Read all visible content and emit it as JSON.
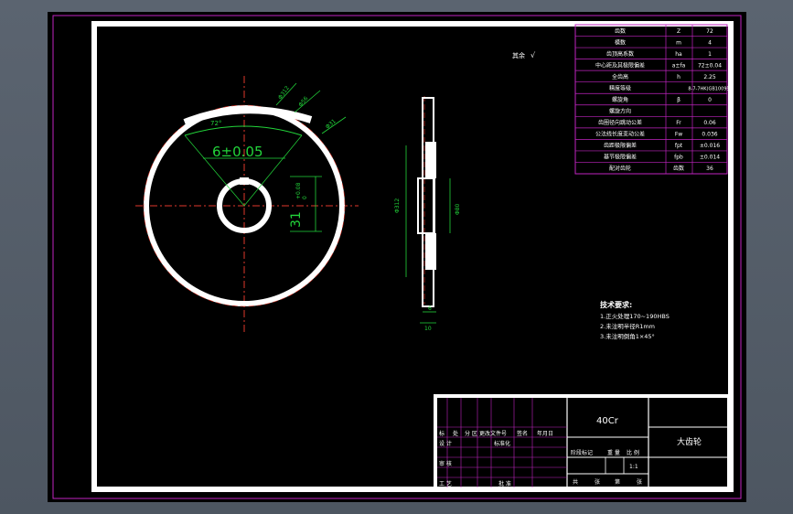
{
  "drawing": {
    "material": "40Cr",
    "part_name": "大齿轮",
    "note_top": "其余",
    "scale": "1:1"
  },
  "dims": {
    "key_width": "6±0.05",
    "key_depth": "31",
    "key_depth_upper": "+0.08",
    "key_depth_lower": "0",
    "angle": "72°",
    "bore_left": "Φ",
    "dim_d1": "Φ312",
    "dim_d2": "Φ56",
    "dim_d3": "Φ31",
    "side_height": "Φ312",
    "side_inner": "Φ80",
    "hub_width": "6",
    "face_width": "10"
  },
  "params": [
    {
      "name": "齿数",
      "sym": "Z",
      "val": "72"
    },
    {
      "name": "模数",
      "sym": "m",
      "val": "4"
    },
    {
      "name": "齿顶高系数",
      "sym": "ha",
      "val": "1"
    },
    {
      "name": "中心距及其极限偏差",
      "sym": "a±fa",
      "val": "72±0.04"
    },
    {
      "name": "全齿高",
      "sym": "h",
      "val": "2.25"
    },
    {
      "name": "精度等级",
      "sym": "",
      "val": "8-7-7HK(GB10095)"
    },
    {
      "name": "螺旋角",
      "sym": "β",
      "val": "0"
    },
    {
      "name": "螺旋方向",
      "sym": "",
      "val": ""
    },
    {
      "name": "齿圈径向跳动公差",
      "sym": "Fr",
      "val": "0.06"
    },
    {
      "name": "公法线长度变动公差",
      "sym": "Fw",
      "val": "0.036"
    },
    {
      "name": "齿距极限偏差",
      "sym": "fpt",
      "val": "±0.016"
    },
    {
      "name": "基节极限偏差",
      "sym": "fpb",
      "val": "±0.014"
    },
    {
      "name": "配对齿轮",
      "sym": "齿数",
      "val": "36"
    }
  ],
  "tech": {
    "title": "技术要求:",
    "items": [
      "1.正火处理170~190HBS",
      "2.未注明半径R1mm",
      "3.未注明倒角1×45°"
    ]
  },
  "title_block": {
    "row1": [
      "标",
      "处",
      "分 区",
      "更改文件号",
      "签名",
      "年月日"
    ],
    "row2": [
      "设 计",
      "标准化"
    ],
    "row3": [
      "审 核"
    ],
    "row4": [
      "工 艺",
      "批 准"
    ],
    "stage_labels": [
      "阶段标记",
      "重 量",
      "比 例"
    ],
    "bottom": [
      "共",
      "张",
      "第",
      "张"
    ]
  }
}
